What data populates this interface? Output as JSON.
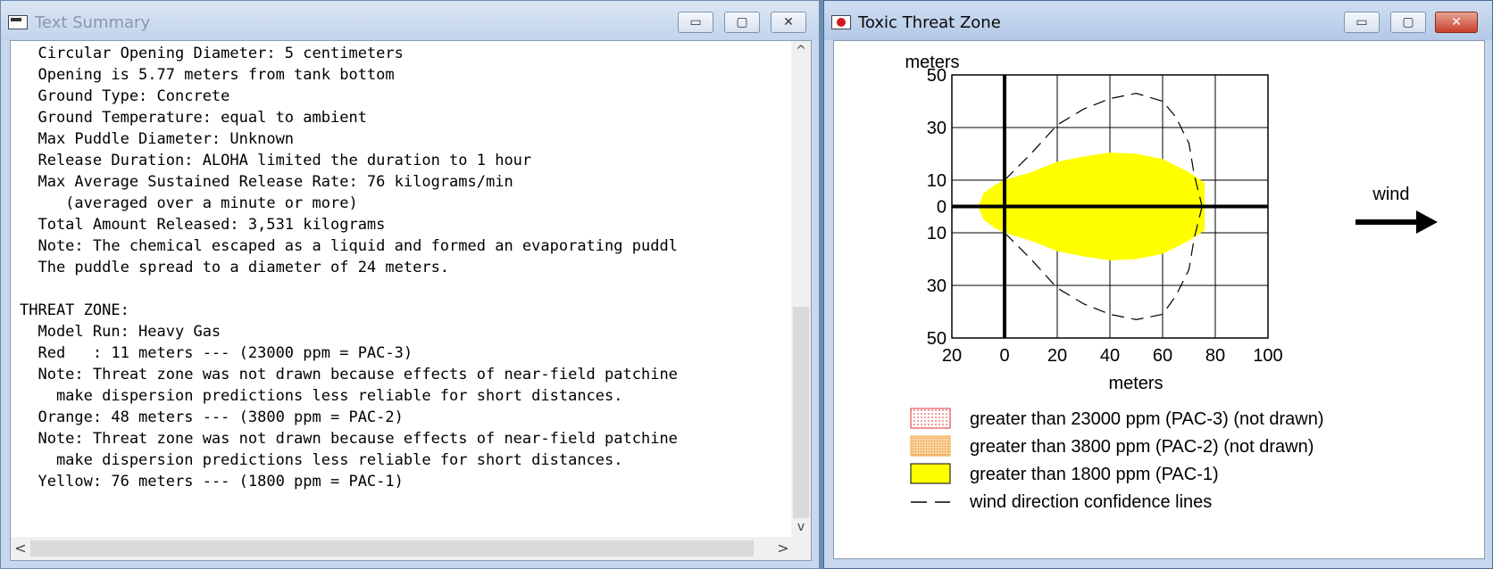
{
  "left_window": {
    "title": "Text Summary",
    "lines": [
      "  Circular Opening Diameter: 5 centimeters",
      "  Opening is 5.77 meters from tank bottom",
      "  Ground Type: Concrete",
      "  Ground Temperature: equal to ambient",
      "  Max Puddle Diameter: Unknown",
      "  Release Duration: ALOHA limited the duration to 1 hour",
      "  Max Average Sustained Release Rate: 76 kilograms/min",
      "     (averaged over a minute or more)",
      "  Total Amount Released: 3,531 kilograms",
      "  Note: The chemical escaped as a liquid and formed an evaporating puddl",
      "  The puddle spread to a diameter of 24 meters.",
      "",
      "THREAT ZONE:",
      "  Model Run: Heavy Gas",
      "  Red   : 11 meters --- (23000 ppm = PAC-3)",
      "  Note: Threat zone was not drawn because effects of near-field patchine",
      "    make dispersion predictions less reliable for short distances.",
      "  Orange: 48 meters --- (3800 ppm = PAC-2)",
      "  Note: Threat zone was not drawn because effects of near-field patchine",
      "    make dispersion predictions less reliable for short distances.",
      "  Yellow: 76 meters --- (1800 ppm = PAC-1)"
    ],
    "controls": {
      "minimize": "▭",
      "maximize": "▢",
      "close": "✕"
    },
    "scroll": {
      "up": "^",
      "down": "v",
      "left": "<",
      "right": ">"
    }
  },
  "right_window": {
    "title": "Toxic Threat Zone",
    "controls": {
      "minimize": "▭",
      "maximize": "▢",
      "close": "✕"
    },
    "wind_label": "wind",
    "legend": [
      {
        "label": "greater than 23000 ppm (PAC-3) (not drawn)",
        "swatch": "red-dotted"
      },
      {
        "label": "greater than 3800 ppm (PAC-2) (not drawn)",
        "swatch": "orange-dotted"
      },
      {
        "label": "greater than 1800 ppm (PAC-1)",
        "swatch": "yellow"
      },
      {
        "label": "wind direction confidence lines",
        "swatch": "dashed"
      }
    ]
  },
  "colors": {
    "threat_yellow": "#ffff00",
    "pac3_red": "#e03030",
    "pac2_orange": "#f4a040"
  },
  "chart_data": {
    "type": "area",
    "xlabel": "meters",
    "ylabel": "meters",
    "xlim": [
      -20,
      100
    ],
    "ylim": [
      -50,
      50
    ],
    "x_ticks": [
      -20,
      0,
      20,
      40,
      60,
      80,
      100
    ],
    "x_tick_labels": [
      "20",
      "0",
      "20",
      "40",
      "60",
      "80",
      "100"
    ],
    "y_ticks": [
      50,
      30,
      10,
      0,
      -10,
      -30,
      -50
    ],
    "y_tick_labels": [
      "50",
      "30",
      "10",
      "0",
      "10",
      "30",
      "50"
    ],
    "grid": true,
    "series": [
      {
        "name": "greater than 1800 ppm (PAC-1)",
        "upper": [
          [
            -10,
            0
          ],
          [
            -8,
            5
          ],
          [
            -4,
            8
          ],
          [
            0,
            10
          ],
          [
            10,
            13
          ],
          [
            20,
            17
          ],
          [
            30,
            19
          ],
          [
            40,
            20.5
          ],
          [
            50,
            20
          ],
          [
            60,
            18
          ],
          [
            70,
            13
          ],
          [
            76,
            9
          ],
          [
            76,
            0
          ]
        ],
        "lower": [
          [
            -10,
            0
          ],
          [
            -8,
            -5
          ],
          [
            -4,
            -8
          ],
          [
            0,
            -10
          ],
          [
            10,
            -13
          ],
          [
            20,
            -17
          ],
          [
            30,
            -19
          ],
          [
            40,
            -20.5
          ],
          [
            50,
            -20
          ],
          [
            60,
            -18
          ],
          [
            70,
            -13
          ],
          [
            76,
            -9
          ],
          [
            76,
            0
          ]
        ]
      },
      {
        "name": "wind direction confidence lines",
        "upper": [
          [
            0,
            10
          ],
          [
            10,
            20
          ],
          [
            20,
            31
          ],
          [
            30,
            37
          ],
          [
            40,
            41
          ],
          [
            50,
            43
          ],
          [
            60,
            40
          ],
          [
            65,
            34
          ],
          [
            70,
            24
          ],
          [
            72,
            12
          ],
          [
            75,
            0
          ]
        ],
        "lower": [
          [
            0,
            -10
          ],
          [
            10,
            -20
          ],
          [
            20,
            -31
          ],
          [
            30,
            -37
          ],
          [
            40,
            -41
          ],
          [
            50,
            -43
          ],
          [
            60,
            -41
          ],
          [
            65,
            -34
          ],
          [
            70,
            -24
          ],
          [
            72,
            -12
          ],
          [
            75,
            0
          ]
        ]
      }
    ]
  }
}
